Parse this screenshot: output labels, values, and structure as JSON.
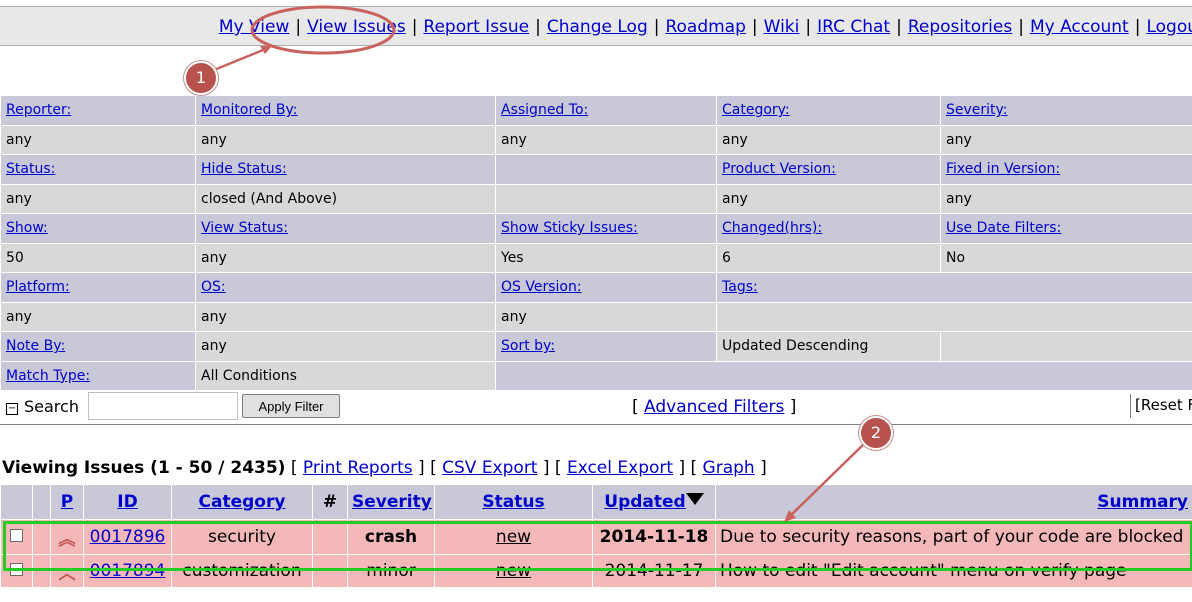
{
  "menu": {
    "items": [
      "My View",
      "View Issues",
      "Report Issue",
      "Change Log",
      "Roadmap",
      "Wiki",
      "IRC Chat",
      "Repositories",
      "My Account",
      "Logou"
    ]
  },
  "callouts": {
    "one": "1",
    "two": "2"
  },
  "filters": {
    "rows": [
      {
        "labels": [
          "Reporter:",
          "Monitored By:",
          "Assigned To:",
          "Category:",
          "Severity:"
        ],
        "values": [
          "any",
          "any",
          "any",
          "any",
          "any"
        ]
      },
      {
        "labels": [
          "Status:",
          "Hide Status:",
          "",
          "Product Version:",
          "Fixed in Version:"
        ],
        "values": [
          "any",
          "closed (And Above)",
          "",
          "any",
          "any"
        ]
      },
      {
        "labels": [
          "Show:",
          "View Status:",
          "Show Sticky Issues:",
          "Changed(hrs):",
          "Use Date Filters:"
        ],
        "values": [
          "50",
          "any",
          "Yes",
          "6",
          "No"
        ]
      },
      {
        "labels": [
          "Platform:",
          "OS:",
          "OS Version:",
          "Tags:"
        ],
        "values": [
          "any",
          "any",
          "any",
          ""
        ]
      },
      {
        "labels": [
          "Note By:",
          "any",
          "Sort by:",
          "Updated Descending",
          ""
        ]
      },
      {
        "labels": [
          "Match Type:",
          "All Conditions",
          ""
        ]
      }
    ]
  },
  "search": {
    "toggle_symbol": "−",
    "label": "Search",
    "input_value": "",
    "apply_label": "Apply Filter",
    "advanced_open": "[",
    "advanced_label": "Advanced Filters",
    "advanced_close": "]",
    "reset_label": "[Reset F"
  },
  "viewing": {
    "title": "Viewing Issues (1 - 50 / 2435)",
    "links": [
      "Print Reports",
      "CSV Export",
      "Excel Export",
      "Graph"
    ]
  },
  "issues": {
    "headers": {
      "p": "P",
      "id": "ID",
      "category": "Category",
      "notes": "#",
      "severity": "Severity",
      "status": "Status",
      "updated": "Updated",
      "summary": "Summary"
    },
    "sort_icon": "descending-triangle",
    "rows": [
      {
        "id": "0017896",
        "category": "security",
        "severity": "crash",
        "status": "new",
        "updated": "2014-11-18",
        "summary": "Due to security reasons, part of your code are blocked",
        "priority_icon": "priority-high-icon",
        "priority_glyph": "︽",
        "bold": true
      },
      {
        "id": "0017894",
        "category": "customization",
        "severity": "minor",
        "status": "new",
        "updated": "2014-11-17",
        "summary": "How to edit \"Edit account\" menu on verify page",
        "priority_icon": "priority-normal-icon",
        "priority_glyph": "︿",
        "bold": false
      }
    ]
  },
  "colors": {
    "link": "#0000cc",
    "header_bg": "#c8c8d8",
    "row_bg": "#f5b8b8",
    "highlight": "#22cc22",
    "callout": "#b8524d"
  }
}
